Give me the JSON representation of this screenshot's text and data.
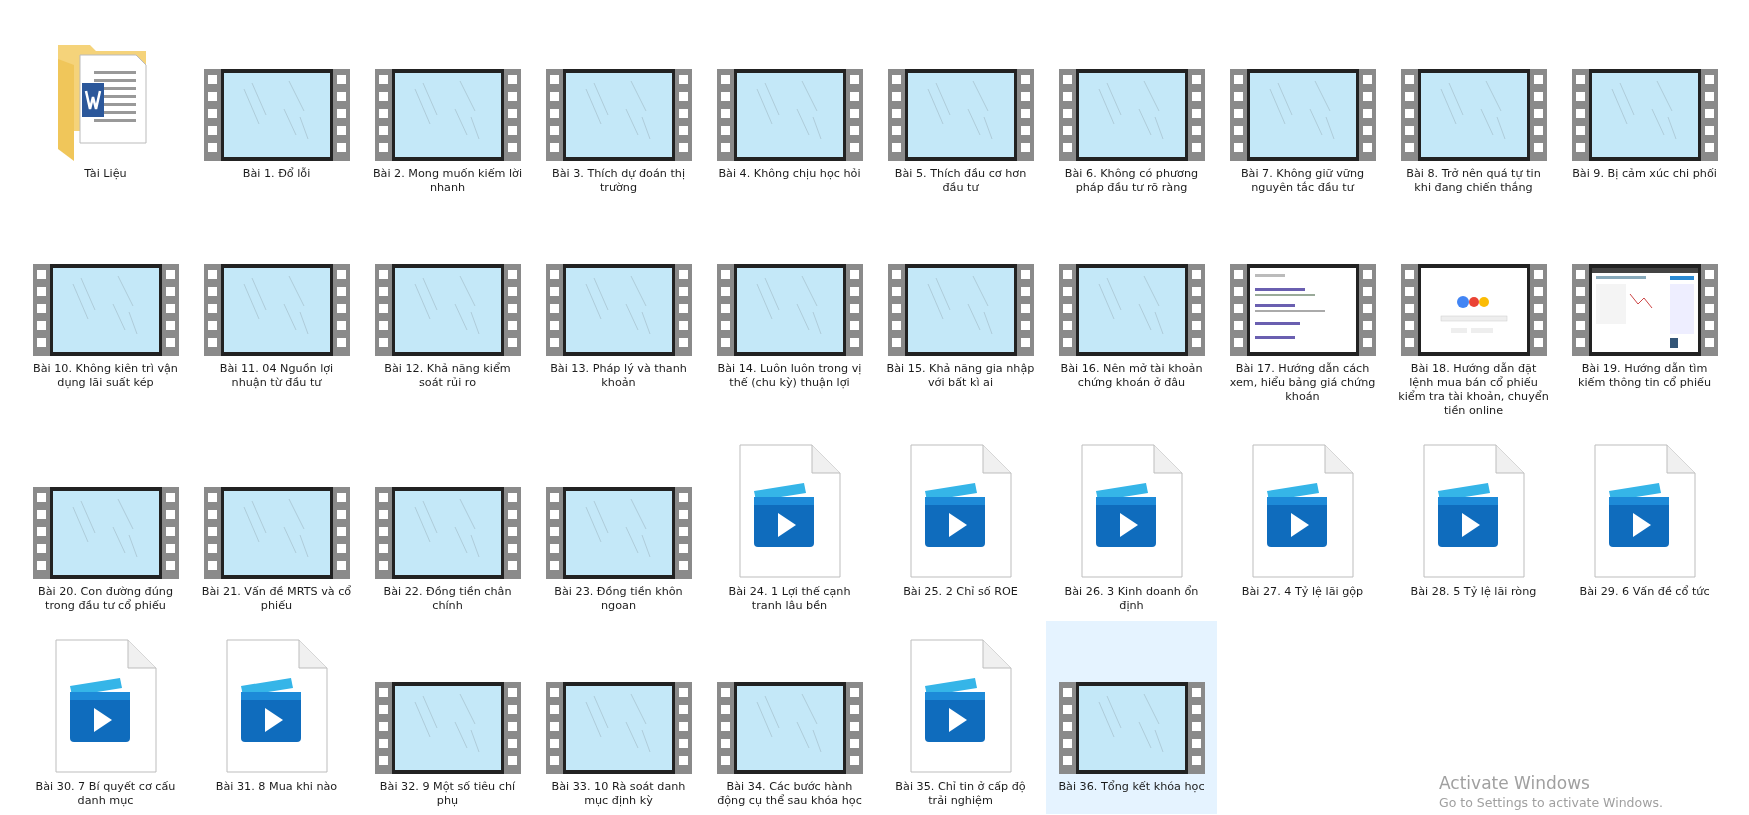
{
  "items": [
    {
      "kind": "folder",
      "name": "Tài Liệu",
      "selected": false
    },
    {
      "kind": "video",
      "name": "Bài 1. Đổ lỗi",
      "selected": false
    },
    {
      "kind": "video",
      "name": "Bài 2. Mong muốn kiếm lời nhanh",
      "selected": false
    },
    {
      "kind": "video",
      "name": "Bài 3. Thích dự đoán thị trường",
      "selected": false
    },
    {
      "kind": "video",
      "name": "Bài 4. Không chịu học hỏi",
      "selected": false
    },
    {
      "kind": "video",
      "name": "Bài 5. Thích đầu cơ hơn đầu tư",
      "selected": false
    },
    {
      "kind": "video",
      "name": "Bài 6. Không có phương pháp đầu tư rõ ràng",
      "selected": false
    },
    {
      "kind": "video",
      "name": "Bài 7. Không giữ vững nguyên tắc đầu tư",
      "selected": false
    },
    {
      "kind": "video",
      "name": "Bài 8. Trở nên quá tự tin khi đang chiến thắng",
      "selected": false
    },
    {
      "kind": "video",
      "name": "Bài 9. Bị cảm xúc chi phối",
      "selected": false
    },
    {
      "kind": "video",
      "name": "Bài 10. Không kiên trì vận dụng lãi suất kép",
      "selected": false
    },
    {
      "kind": "video",
      "name": "Bài 11. 04 Nguồn lợi nhuận từ đầu tư",
      "selected": false
    },
    {
      "kind": "video",
      "name": "Bài 12. Khả năng kiểm soát rủi ro",
      "selected": false
    },
    {
      "kind": "video",
      "name": "Bài 13. Pháp lý và thanh khoản",
      "selected": false
    },
    {
      "kind": "video",
      "name": "Bài 14. Luôn luôn trong vị thế (chu kỳ) thuận lợi",
      "selected": false
    },
    {
      "kind": "video",
      "name": "Bài 15. Khả năng gia nhập với bất kì ai",
      "selected": false
    },
    {
      "kind": "video",
      "name": "Bài 16. Nên mở tài khoản chứng khoán ở đâu",
      "selected": false
    },
    {
      "kind": "picture",
      "name": "Bài 17. Hướng dẫn cách xem, hiểu bảng giá chứng khoán",
      "selected": false
    },
    {
      "kind": "picture",
      "name": "Bài 18. Hướng dẫn đặt lệnh mua bán cổ phiếu kiểm tra tài khoản, chuyển tiền online",
      "selected": false
    },
    {
      "kind": "picture",
      "name": "Bài 19. Hướng dẫn tìm kiếm thông tin cổ phiếu",
      "selected": false
    },
    {
      "kind": "video",
      "name": "Bài 20. Con đường đúng trong đầu tư cổ phiếu",
      "selected": false
    },
    {
      "kind": "video",
      "name": "Bài 21. Vấn đề MRTS và cổ phiếu",
      "selected": false
    },
    {
      "kind": "video",
      "name": "Bài 22. Đồng tiền chân chính",
      "selected": false
    },
    {
      "kind": "video",
      "name": "Bài 23. Đồng tiền khôn ngoan",
      "selected": false
    },
    {
      "kind": "media",
      "name": "Bài 24. 1 Lợi thế cạnh tranh lâu bền",
      "selected": false
    },
    {
      "kind": "media",
      "name": "Bài 25. 2 Chỉ số ROE",
      "selected": false
    },
    {
      "kind": "media",
      "name": "Bài 26. 3 Kinh doanh ổn định",
      "selected": false
    },
    {
      "kind": "media",
      "name": "Bài 27. 4 Tỷ lệ lãi gộp",
      "selected": false
    },
    {
      "kind": "media",
      "name": "Bài 28. 5 Tỷ lệ lãi ròng",
      "selected": false
    },
    {
      "kind": "media",
      "name": "Bài 29. 6 Vấn đề cổ tức",
      "selected": false
    },
    {
      "kind": "media",
      "name": "Bài 30. 7 Bí quyết cơ cấu danh mục",
      "selected": false
    },
    {
      "kind": "media",
      "name": "Bài 31. 8 Mua khi nào",
      "selected": false
    },
    {
      "kind": "video",
      "name": "Bài 32. 9 Một số tiêu chí phụ",
      "selected": false
    },
    {
      "kind": "video",
      "name": "Bài 33. 10 Rà soát danh mục định kỳ",
      "selected": false
    },
    {
      "kind": "video",
      "name": "Bài 34. Các bước hành động cụ thể sau khóa học",
      "selected": false
    },
    {
      "kind": "media",
      "name": "Bài 35. Chỉ tin ở cấp độ trải nghiệm",
      "selected": false
    },
    {
      "kind": "video",
      "name": "Bài 36. Tổng kết khóa học",
      "selected": true
    }
  ],
  "activation_notice": {
    "title": "Activate Windows",
    "text": "Go to Settings to activate Windows."
  }
}
